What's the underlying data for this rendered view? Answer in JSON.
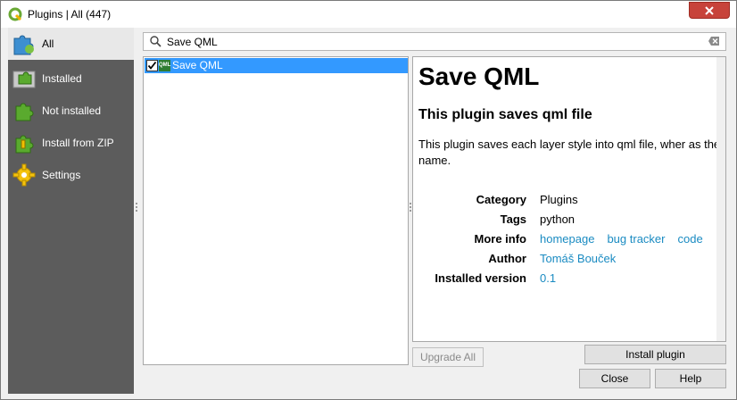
{
  "window": {
    "title": "Plugins | All (447)"
  },
  "sidebar": {
    "items": [
      {
        "label": "All",
        "icon": "puzzle-blue-icon",
        "active": true
      },
      {
        "label": "Installed",
        "icon": "puzzle-installed-icon"
      },
      {
        "label": "Not installed",
        "icon": "puzzle-green-icon"
      },
      {
        "label": "Install from ZIP",
        "icon": "puzzle-zip-icon"
      },
      {
        "label": "Settings",
        "icon": "gear-icon"
      }
    ]
  },
  "search": {
    "value": "Save QML"
  },
  "list": {
    "items": [
      {
        "name": "Save QML",
        "checked": true,
        "icon_text": "QML"
      }
    ]
  },
  "details": {
    "title": "Save QML",
    "subtitle": "This plugin saves qml file",
    "description": "This plugin saves each layer style into qml file, wher as the layer name.",
    "meta": {
      "category_label": "Category",
      "category_value": "Plugins",
      "tags_label": "Tags",
      "tags_value": "python",
      "moreinfo_label": "More info",
      "link_homepage": "homepage",
      "link_bugtracker": "bug tracker",
      "link_code": "code",
      "author_label": "Author",
      "author_value": "Tomáš Bouček",
      "installed_label": "Installed version",
      "installed_value": "0.1"
    }
  },
  "buttons": {
    "install": "Install plugin",
    "upgrade_all": "Upgrade All",
    "close": "Close",
    "help": "Help"
  },
  "colors": {
    "sidebar_bg": "#5c5c5c",
    "selection": "#3399ff",
    "link": "#1a8bc2",
    "close_red": "#c7433a"
  }
}
